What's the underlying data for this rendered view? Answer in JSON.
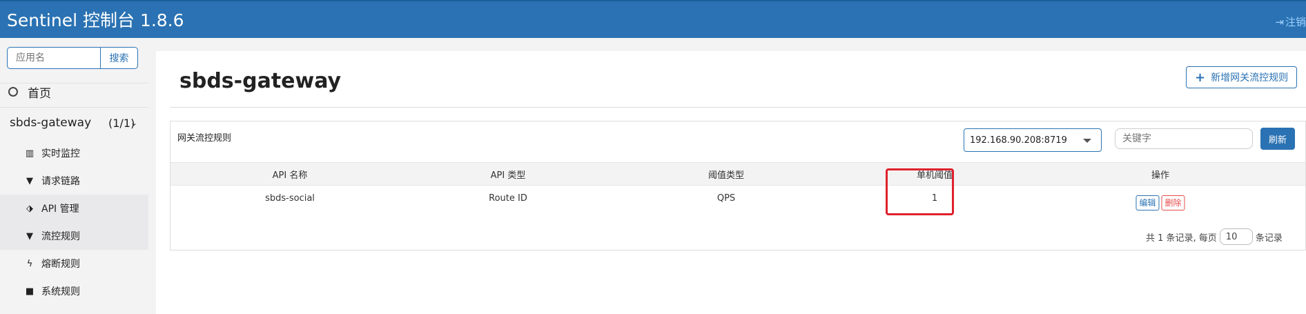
{
  "header": {
    "title": "Sentinel 控制台 1.8.6",
    "logout_label": "注销"
  },
  "sidebar": {
    "search_placeholder": "应用名",
    "search_button": "搜索",
    "home_label": "首页",
    "app_name": "sbds-gateway",
    "app_count": "(1/1)",
    "items": [
      {
        "label": "实时监控",
        "icon": "bar-chart-icon"
      },
      {
        "label": "请求链路",
        "icon": "filter-icon"
      },
      {
        "label": "API 管理",
        "icon": "tags-icon"
      },
      {
        "label": "流控规则",
        "icon": "filter-icon"
      },
      {
        "label": "熔断规则",
        "icon": "flash-icon"
      },
      {
        "label": "系统规则",
        "icon": "lock-icon"
      }
    ]
  },
  "main": {
    "title": "sbds-gateway",
    "add_button": "新增网关流控规则",
    "panel_title": "网关流控规则",
    "machine": "192.168.90.208:8719",
    "keyword_placeholder": "关键字",
    "refresh_button": "刷新",
    "columns": [
      "API 名称",
      "API 类型",
      "阈值类型",
      "单机阈值",
      "操作"
    ],
    "rows": [
      {
        "api_name": "sbds-social",
        "api_type": "Route ID",
        "threshold_type": "QPS",
        "threshold": "1",
        "edit": "编辑",
        "delete": "删除"
      }
    ],
    "pager": {
      "prefix": "共 1 条记录, 每页",
      "page_size": "10",
      "suffix": "条记录"
    }
  },
  "colors": {
    "brand": "#2a72b3",
    "danger": "#e54b4b",
    "highlight": "#e0202c"
  }
}
